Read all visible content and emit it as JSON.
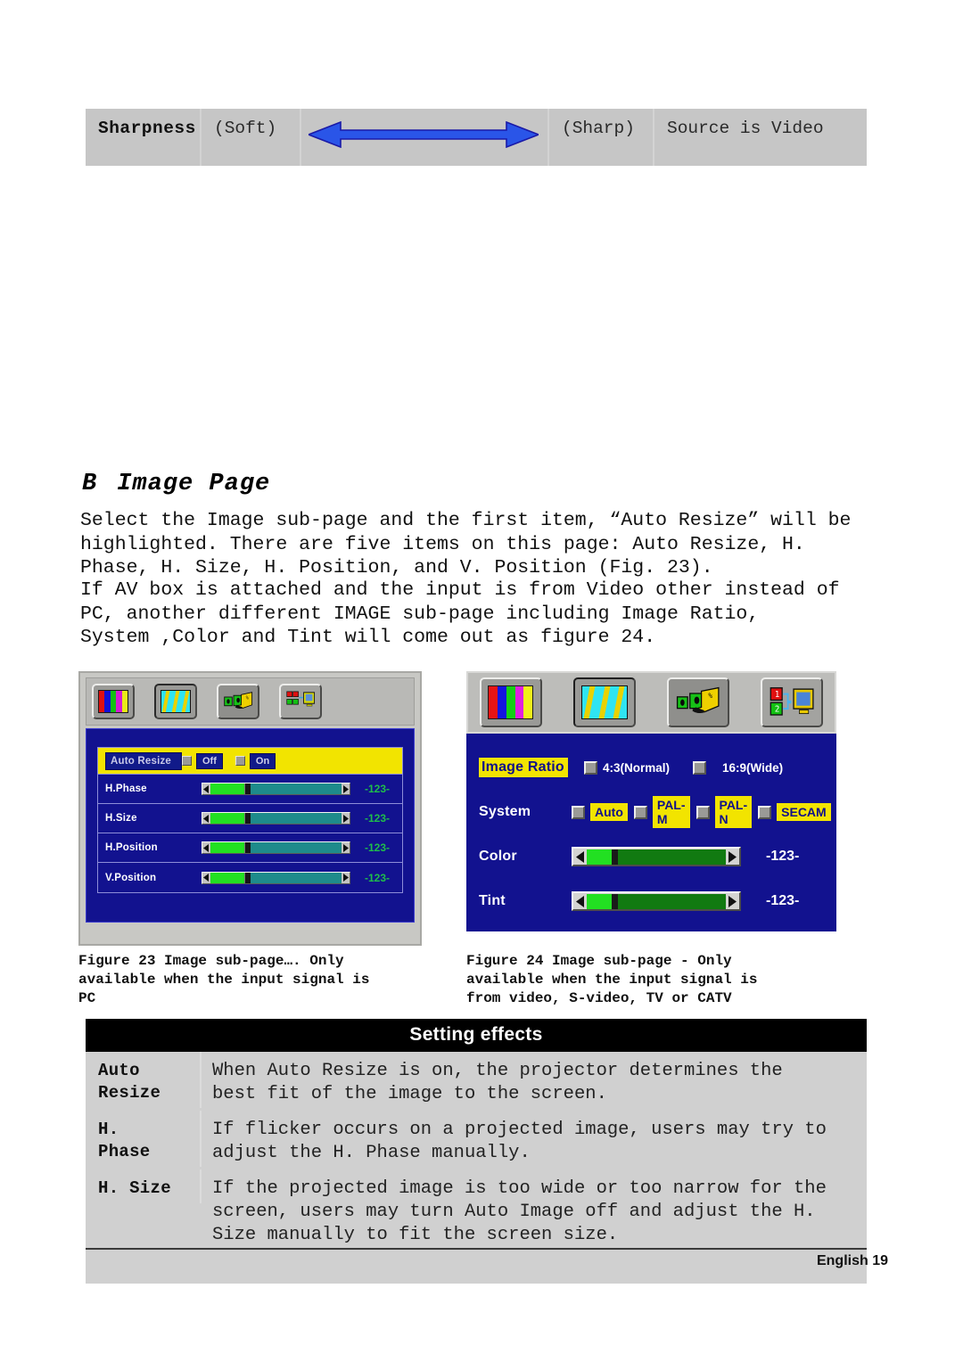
{
  "sharpness_table": {
    "name": "Sharpness",
    "low_label": "(Soft)",
    "arrow": "double-headed-arrow",
    "high_label": "(Sharp)",
    "note": "Source is Video",
    "arrow_color": "#2a55e8"
  },
  "section": {
    "letter": "B",
    "title": "Image Page"
  },
  "paragraphs": {
    "p1": [
      "Select the Image sub-page and the first item, “Auto Resize” will be",
      "highlighted. There are five items on this page: Auto Resize, H.",
      "Phase, H. Size, H. Position, and V. Position (Fig. 23)."
    ],
    "p2": [
      "If AV box is attached and the input is from Video other instead of",
      "PC, another different IMAGE sub-page including Image Ratio,",
      "System ,Color and Tint will come out as figure 24."
    ]
  },
  "figure23": {
    "icons": [
      "color-bars-icon",
      "image-stripes-icon",
      "remote-hand-icon",
      "source-pc-icon"
    ],
    "rows": [
      {
        "label": "Auto Resize",
        "type": "options",
        "highlighted": true,
        "options": [
          "Off",
          "On"
        ]
      },
      {
        "label": "H.Phase",
        "type": "slider",
        "value": "-123-",
        "fill_pct": 26
      },
      {
        "label": "H.Size",
        "type": "slider",
        "value": "-123-",
        "fill_pct": 26
      },
      {
        "label": "H.Position",
        "type": "slider",
        "value": "-123-",
        "fill_pct": 26
      },
      {
        "label": "V.Position",
        "type": "slider",
        "value": "-123-",
        "fill_pct": 26
      }
    ],
    "caption": [
      "Figure 23 Image sub-page…. Only",
      "available when the input signal is",
      "PC"
    ]
  },
  "figure24": {
    "icons": [
      "color-bars-icon",
      "image-stripes-icon",
      "remote-hand-icon",
      "source-pc-icon"
    ],
    "rows": [
      {
        "label": "Image Ratio",
        "type": "options-plain",
        "highlighted": true,
        "options": [
          "4:3(Normal)",
          "16:9(Wide)"
        ]
      },
      {
        "label": "System",
        "type": "options-yellow",
        "highlighted": false,
        "options": [
          "Auto",
          "PAL-M",
          "PAL-N",
          "SECAM"
        ]
      },
      {
        "label": "Color",
        "type": "slider",
        "value": "-123-",
        "fill_pct": 18
      },
      {
        "label": "Tint",
        "type": "slider",
        "value": "-123-",
        "fill_pct": 18
      }
    ],
    "caption": [
      "Figure 24 Image sub-page - Only",
      "available when the input signal is",
      "from video, S-video, TV or CATV"
    ]
  },
  "effects_table": {
    "header": "Setting effects",
    "rows": [
      {
        "term": [
          "Auto",
          "Resize"
        ],
        "lines": [
          "When Auto Resize is on, the projector determines the",
          "best fit of the image to the screen."
        ]
      },
      {
        "term": [
          "H.",
          "Phase"
        ],
        "lines": [
          "If flicker occurs on a projected image, users may try to",
          "adjust the H. Phase manually."
        ]
      },
      {
        "term": [
          "H. Size"
        ],
        "lines": [
          "If the projected image is too wide or too narrow for the",
          "screen, users may turn Auto Image off and adjust the H.",
          "Size manually to fit the screen size."
        ]
      }
    ]
  },
  "footer": {
    "text": "English 19"
  }
}
